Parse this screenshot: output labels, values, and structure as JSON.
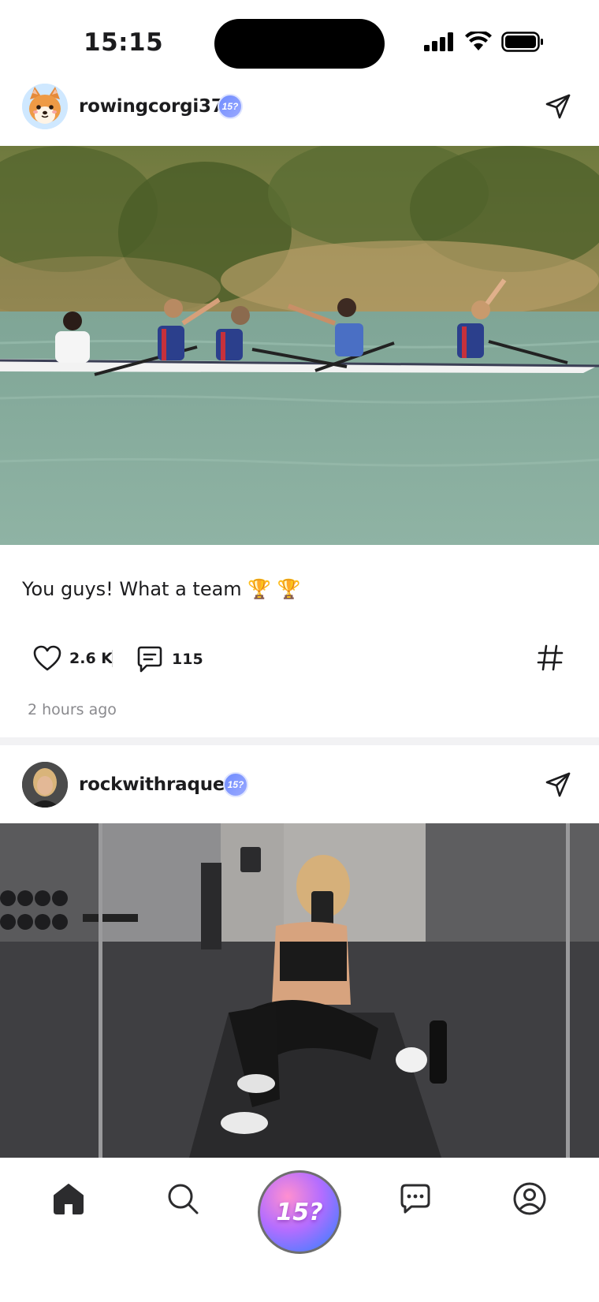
{
  "status_bar": {
    "time": "15:15",
    "icons": [
      "cellular-signal-icon",
      "wifi-icon",
      "battery-icon"
    ]
  },
  "posts": [
    {
      "username": "rowingcorgi37",
      "badge": "15?",
      "caption": "You guys! What a team 🏆 🏆",
      "likes": "2.6 K",
      "comments": "115",
      "timestamp": "2 hours ago"
    },
    {
      "username": "rockwithraquel",
      "badge": "15?"
    }
  ],
  "tab_bar": {
    "items": [
      "home-icon",
      "search-icon",
      "create-button",
      "messages-icon",
      "profile-icon"
    ],
    "center_label": "15?"
  },
  "colors": {
    "accent": "#6f8cff",
    "fab_pink": "#ff8fd0",
    "fab_purple": "#b46dff",
    "fab_blue": "#5b7bff"
  }
}
